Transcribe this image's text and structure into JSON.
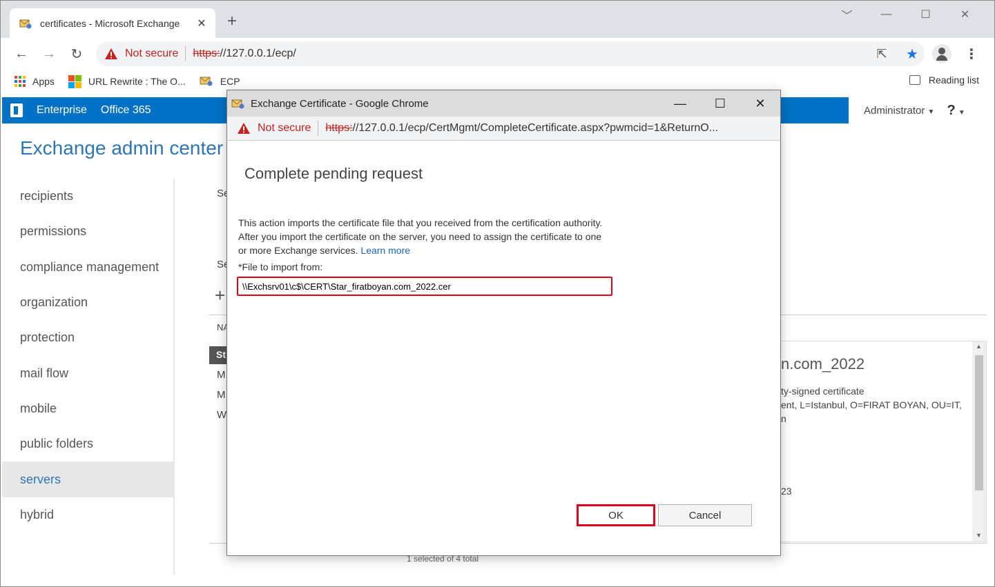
{
  "browser": {
    "tab_title": "certificates - Microsoft Exchange",
    "not_secure": "Not secure",
    "url_scheme": "https:",
    "url_rest": "//127.0.0.1/ecp/",
    "bookmarks": [
      "Apps",
      "URL Rewrite : The O...",
      "ECP"
    ],
    "reading_list": "Reading list"
  },
  "eac": {
    "nav_enterprise": "Enterprise",
    "nav_office365": "Office 365",
    "user": "Administrator",
    "help": "?",
    "title": "Exchange admin center",
    "left_nav": [
      "recipients",
      "permissions",
      "compliance management",
      "organization",
      "protection",
      "mail flow",
      "mobile",
      "public folders",
      "servers",
      "hybrid"
    ],
    "active_nav": "servers",
    "bg_fragments": {
      "se1": "Se",
      "se2": "Se",
      "plus": "+",
      "na": "NA",
      "st": "St",
      "m1": "M",
      "m2": "M",
      "w": "W",
      "detail_title": "n.com_2022",
      "detail_line1": "ty-signed certificate",
      "detail_line2": "ent, L=Istanbul, O=FIRAT BOYAN, OU=IT,",
      "detail_line3": "n",
      "detail_line4": "23",
      "status": "1 selected of 4 total"
    }
  },
  "popup": {
    "window_title": "Exchange Certificate - Google Chrome",
    "not_secure": "Not secure",
    "url_scheme": "https:",
    "url_rest": "//127.0.0.1/ecp/CertMgmt/CompleteCertificate.aspx?pwmcid=1&ReturnO...",
    "heading": "Complete pending request",
    "description": "This action imports the certificate file that you received from the certification authority. After you import the certificate on the server, you need to assign the certificate to one or more Exchange services.",
    "learn_more": "Learn more",
    "file_label": "*File to import from:",
    "file_value": "\\\\Exchsrv01\\c$\\CERT\\Star_firatboyan.com_2022.cer",
    "ok_label": "OK",
    "cancel_label": "Cancel"
  },
  "colors": {
    "eac_blue": "#0072c6",
    "title_blue": "#2e75b5",
    "highlight_red": "#e0001b",
    "warning_red": "#c5221f"
  }
}
